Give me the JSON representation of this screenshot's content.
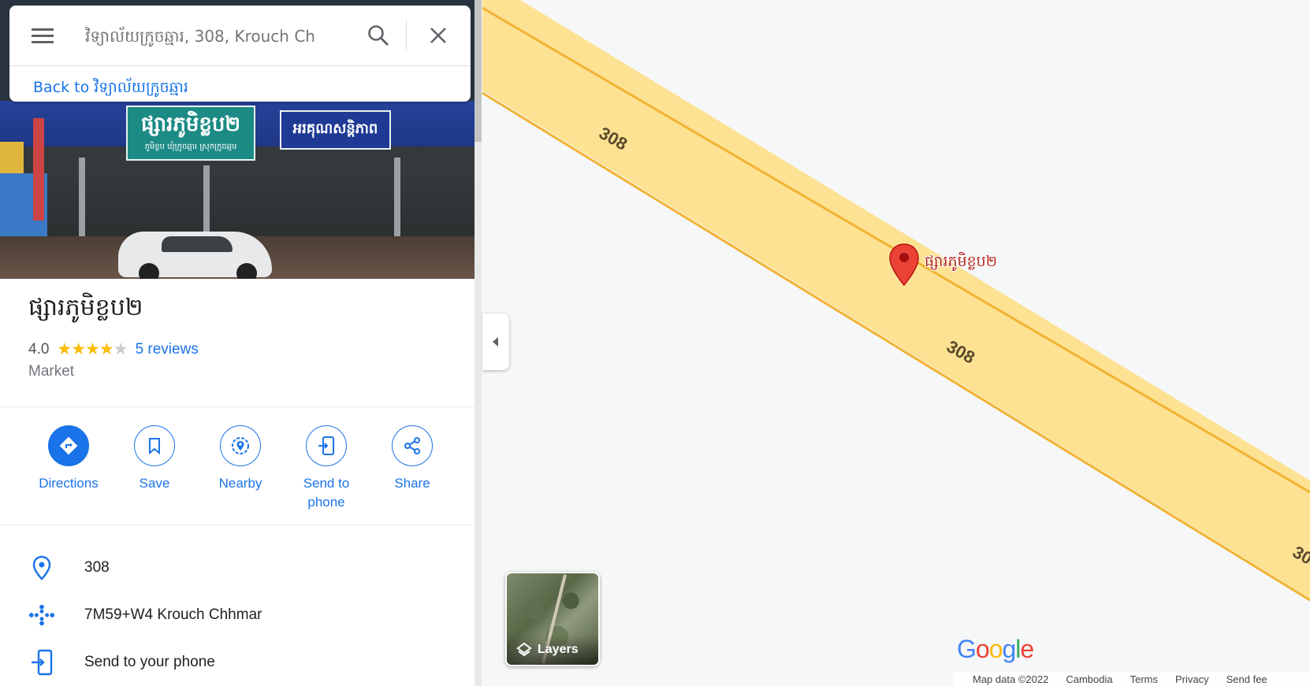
{
  "search": {
    "placeholder": "វិទ្យាល័យក្រូចឆ្មារ, 308, Krouch Ch",
    "back_label": "Back to វិទ្យាល័យក្រូចឆ្មារ"
  },
  "place": {
    "name": "ផ្សារភូមិខ្លប២",
    "rating": "4.0",
    "stars": 4,
    "reviews": "5 reviews",
    "category": "Market"
  },
  "actions": [
    {
      "label": "Directions",
      "icon": "directions-icon"
    },
    {
      "label": "Save",
      "icon": "bookmark-icon"
    },
    {
      "label": "Nearby",
      "icon": "nearby-icon"
    },
    {
      "label": "Send to\nphone",
      "icon": "send-to-phone-icon"
    },
    {
      "label": "Share",
      "icon": "share-icon"
    }
  ],
  "info": [
    {
      "text": "308",
      "icon": "location-pin-icon"
    },
    {
      "text": "7M59+W4 Krouch Chhmar",
      "icon": "plus-code-icon"
    },
    {
      "text": "Send to your phone",
      "icon": "send-to-phone-icon"
    }
  ],
  "map": {
    "road_label": "308",
    "pin_label": "ផ្សារភូមិខ្លប២",
    "layers_label": "Layers",
    "footer": [
      "Map data ©2022",
      "Cambodia",
      "Terms",
      "Privacy",
      "Send fee"
    ]
  },
  "colors": {
    "accent": "#1a73e8",
    "road_fill": "#fde293",
    "road_edge": "#f2b233",
    "pin": "#ea4335",
    "star": "#fbbc04"
  }
}
